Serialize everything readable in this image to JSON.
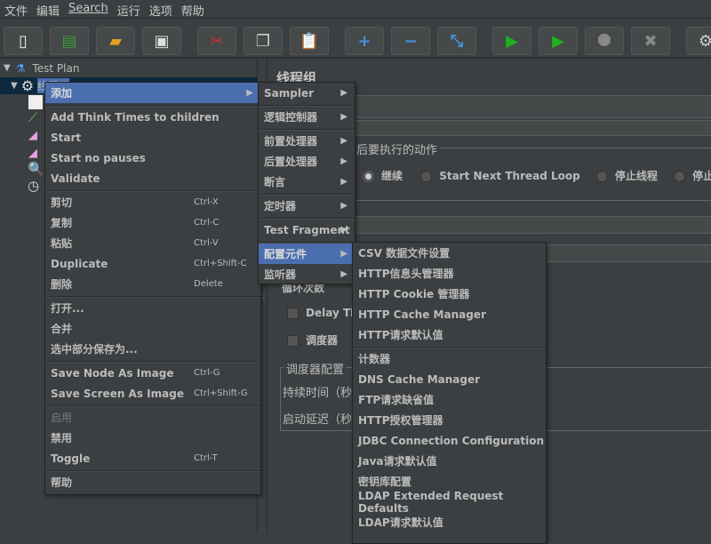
{
  "menubar": [
    "文件",
    "编辑",
    "Search",
    "运行",
    "选项",
    "帮助"
  ],
  "toolbar": [
    {
      "name": "new-icon",
      "glyph": "▯",
      "color": "#eeeeee"
    },
    {
      "name": "templates-icon",
      "glyph": "▤",
      "color": "#3a9a3a"
    },
    {
      "name": "open-icon",
      "glyph": "▰",
      "color": "#e0a020"
    },
    {
      "name": "save-icon",
      "glyph": "▣",
      "color": "#dddddd"
    },
    {
      "name": "cut-icon",
      "glyph": "✂",
      "color": "#d03030"
    },
    {
      "name": "copy-icon",
      "glyph": "❐",
      "color": "#cccccc"
    },
    {
      "name": "paste-icon",
      "glyph": "📋",
      "color": "#c08040"
    },
    {
      "name": "expand-icon",
      "glyph": "+",
      "color": "#4a90e0"
    },
    {
      "name": "collapse-icon",
      "glyph": "−",
      "color": "#4a90e0"
    },
    {
      "name": "toggle-icon",
      "glyph": "⤡",
      "color": "#4a90e0"
    },
    {
      "name": "start-icon",
      "glyph": "▶",
      "color": "#20b020"
    },
    {
      "name": "start-no-pauses-icon",
      "glyph": "▶",
      "color": "#20b020"
    },
    {
      "name": "stop-icon",
      "glyph": "⯃",
      "color": "#888888"
    },
    {
      "name": "shutdown-icon",
      "glyph": "✖",
      "color": "#888888"
    },
    {
      "name": "settings-icon",
      "glyph": "⚙",
      "color": "#cccccc"
    }
  ],
  "tree": {
    "root": "Test Plan",
    "selected": "线程组"
  },
  "right": {
    "title": "线程组",
    "action_legend": "后要执行的动作",
    "radios": [
      "继续",
      "Start Next Thread Loop",
      "停止线程",
      "停止测试"
    ],
    "loop_label": "循环次数",
    "delay_label": "Delay Thr",
    "scheduler_label": "调度器",
    "scheduler_config": "调度器配置",
    "duration_label": "持续时间（秒",
    "startup_delay_label": "启动延迟（秒"
  },
  "context_menu": {
    "items": [
      {
        "label": "添加",
        "arrow": true,
        "selected": true
      },
      {
        "sep": true
      },
      {
        "label": "Add Think Times to children"
      },
      {
        "label": "Start"
      },
      {
        "label": "Start no pauses"
      },
      {
        "label": "Validate"
      },
      {
        "sep": true
      },
      {
        "label": "剪切",
        "shortcut": "Ctrl-X"
      },
      {
        "label": "复制",
        "shortcut": "Ctrl-C"
      },
      {
        "label": "粘贴",
        "shortcut": "Ctrl-V"
      },
      {
        "label": "Duplicate",
        "shortcut": "Ctrl+Shift-C"
      },
      {
        "label": "删除",
        "shortcut": "Delete"
      },
      {
        "sep": true
      },
      {
        "label": "打开..."
      },
      {
        "label": "合并"
      },
      {
        "label": "选中部分保存为..."
      },
      {
        "sep": true
      },
      {
        "label": "Save Node As Image",
        "shortcut": "Ctrl-G"
      },
      {
        "label": "Save Screen As Image",
        "shortcut": "Ctrl+Shift-G"
      },
      {
        "sep": true
      },
      {
        "label": "启用",
        "disabled": true
      },
      {
        "label": "禁用"
      },
      {
        "label": "Toggle",
        "shortcut": "Ctrl-T"
      },
      {
        "sep": true
      },
      {
        "label": "帮助"
      }
    ]
  },
  "add_submenu": {
    "items": [
      {
        "label": "Sampler",
        "arrow": true
      },
      {
        "sep": true
      },
      {
        "label": "逻辑控制器",
        "arrow": true
      },
      {
        "sep": true
      },
      {
        "label": "前置处理器",
        "arrow": true
      },
      {
        "label": "后置处理器",
        "arrow": true
      },
      {
        "label": "断言",
        "arrow": true
      },
      {
        "sep": true
      },
      {
        "label": "定时器",
        "arrow": true
      },
      {
        "sep": true
      },
      {
        "label": "Test Fragment",
        "arrow": true
      },
      {
        "sep": true
      },
      {
        "label": "配置元件",
        "arrow": true,
        "selected": true
      },
      {
        "label": "监听器",
        "arrow": true
      }
    ]
  },
  "config_submenu": {
    "items": [
      {
        "label": "CSV 数据文件设置"
      },
      {
        "label": "HTTP信息头管理器"
      },
      {
        "label": "HTTP Cookie 管理器"
      },
      {
        "label": "HTTP Cache Manager"
      },
      {
        "label": "HTTP请求默认值"
      },
      {
        "sep": true
      },
      {
        "label": "计数器"
      },
      {
        "label": "DNS Cache Manager"
      },
      {
        "label": "FTP请求缺省值"
      },
      {
        "label": "HTTP授权管理器"
      },
      {
        "label": "JDBC Connection Configuration"
      },
      {
        "label": "Java请求默认值"
      },
      {
        "label": "密钥库配置"
      },
      {
        "label": "LDAP Extended Request Defaults"
      },
      {
        "label": "LDAP请求默认值"
      }
    ]
  },
  "colors": {
    "background": "#3c3f41",
    "selection": "#4b6eaf",
    "tree_selection": "#0d293e"
  }
}
